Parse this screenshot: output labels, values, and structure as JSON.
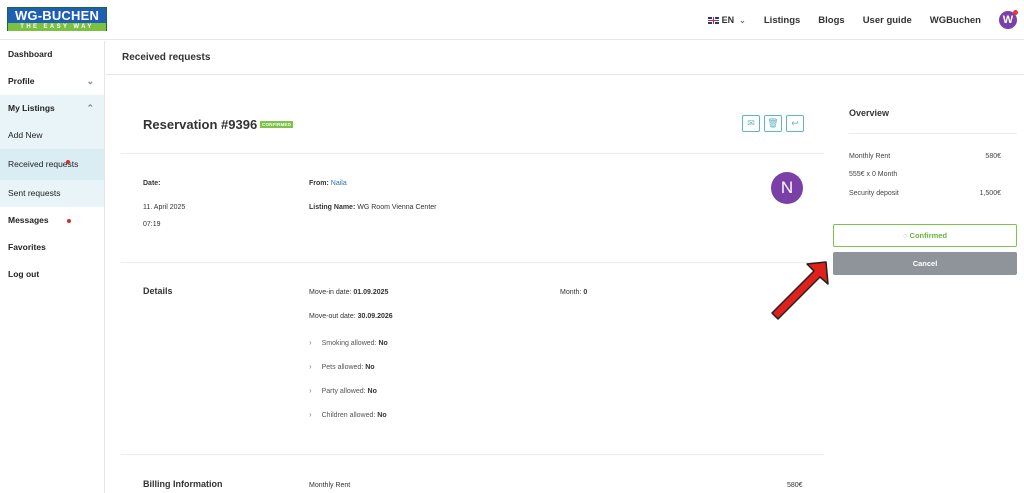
{
  "header": {
    "logo_top": "WG-BUCHEN",
    "logo_bottom": "THE EASY WAY",
    "lang": "EN",
    "nav": [
      "Listings",
      "Blogs",
      "User guide",
      "WGBuchen"
    ],
    "avatar_initial": "W"
  },
  "sidebar": {
    "items": [
      {
        "label": "Dashboard"
      },
      {
        "label": "Profile"
      },
      {
        "label": "My Listings"
      },
      {
        "label": "Add New"
      },
      {
        "label": "Received requests"
      },
      {
        "label": "Sent requests"
      },
      {
        "label": "Messages"
      },
      {
        "label": "Favorites"
      },
      {
        "label": "Log out"
      }
    ]
  },
  "page": {
    "title": "Received requests"
  },
  "reservation": {
    "title": "Reservation #9396",
    "status_badge": "CONFIRMED",
    "date_label": "Date:",
    "date": "11. April 2025",
    "time": "07:19",
    "from_label": "From:",
    "from_name": "Naila",
    "listing_label": "Listing Name:",
    "listing_name": "WG Room Vienna Center",
    "avatar_initial": "N"
  },
  "details": {
    "title": "Details",
    "move_in_label": "Move-in date:",
    "move_in": "01.09.2025",
    "move_out_label": "Move-out date:",
    "move_out": "30.09.2026",
    "month_label": "Month:",
    "month": "0",
    "rules": [
      {
        "label": "Smoking allowed:",
        "value": "No"
      },
      {
        "label": "Pets allowed:",
        "value": "No"
      },
      {
        "label": "Party allowed:",
        "value": "No"
      },
      {
        "label": "Children allowed:",
        "value": "No"
      }
    ]
  },
  "billing": {
    "title": "Billing Information",
    "monthly_rent_label": "Monthly Rent",
    "monthly_rent": "580€"
  },
  "overview": {
    "title": "Overview",
    "monthly_rent_label": "Monthly Rent",
    "monthly_rent": "580€",
    "calc": "555€ x 0 Month",
    "deposit_label": "Security deposit",
    "deposit": "1,500€",
    "confirmed_label": "Confirmed",
    "cancel_label": "Cancel"
  },
  "colors": {
    "accent_teal": "#5fb4c7",
    "confirmed_green": "#7cc34a",
    "avatar_purple": "#7b3fa8",
    "cancel_gray": "#8e949a",
    "arrow_red": "#e0201b"
  }
}
